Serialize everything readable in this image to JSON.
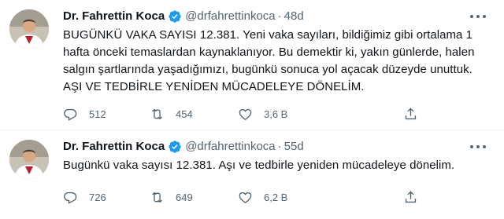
{
  "colors": {
    "accent": "#1d9bf0",
    "text": "#0f1419",
    "muted": "#536471",
    "divider": "#eff3f4"
  },
  "tweets": [
    {
      "name": "Dr. Fahrettin Koca",
      "handle": "@drfahrettinkoca",
      "dot": "·",
      "time": "48d",
      "text": "BUGÜNKÜ VAKA SAYISI 12.381. Yeni vaka sayıları, bildiğimiz gibi ortalama 1 hafta önceki temaslardan kaynaklanıyor. Bu demektir ki, yakın günlerde, halen salgın şartlarında yaşadığımızı, bugünkü sonuca yol açacak düzeyde unuttuk. AŞI VE TEDBİRLE YENİDEN MÜCADELEYE DÖNELİM.",
      "replies": "512",
      "retweets": "454",
      "likes": "3,6 B"
    },
    {
      "name": "Dr. Fahrettin Koca",
      "handle": "@drfahrettinkoca",
      "dot": "·",
      "time": "55d",
      "text": "Bugünkü vaka sayısı 12.381. Aşı ve tedbirle yeniden mücadeleye dönelim.",
      "replies": "726",
      "retweets": "649",
      "likes": "6,2 B"
    }
  ],
  "icons": {
    "verified": "verified-badge-icon",
    "more": "more-options-icon",
    "reply": "reply-icon",
    "retweet": "retweet-icon",
    "like": "heart-icon",
    "share": "share-icon"
  }
}
